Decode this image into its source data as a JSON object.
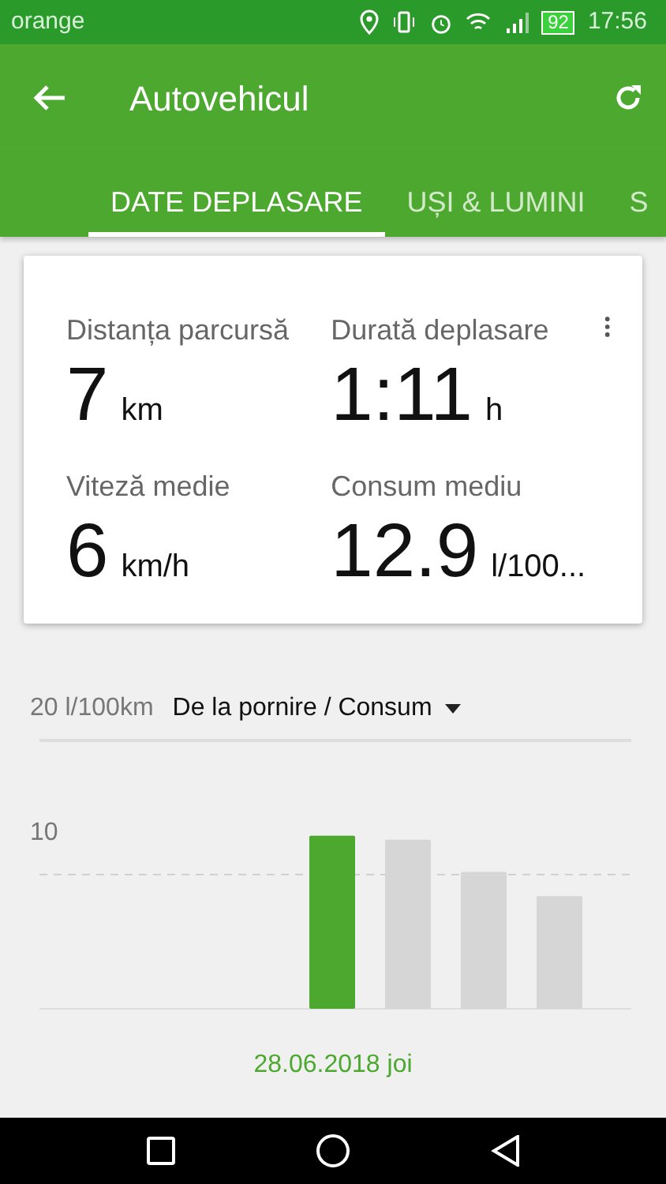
{
  "status_bar": {
    "carrier": "orange",
    "battery": "92",
    "time": "17:56"
  },
  "app_bar": {
    "title": "Autovehicul"
  },
  "tabs": [
    {
      "label": "DATE DEPLASARE",
      "selected": true
    },
    {
      "label": "UȘI & LUMINI",
      "selected": false
    },
    {
      "label": "S",
      "selected": false
    }
  ],
  "stats": [
    {
      "label": "Distanța parcursă",
      "value": "7",
      "unit": "km"
    },
    {
      "label": "Durată deplasare",
      "value": "1:11",
      "unit": "h"
    },
    {
      "label": "Viteză medie",
      "value": "6",
      "unit": "km/h"
    },
    {
      "label": "Consum mediu",
      "value": "12.9",
      "unit": "l/100..."
    }
  ],
  "chart": {
    "dropdown": "De la pornire / Consum",
    "date": "28.06.2018 joi",
    "axis_labels": [
      "20 l/100km",
      "10"
    ],
    "bars": [
      {
        "selected": true
      },
      {
        "selected": false
      },
      {
        "selected": false
      },
      {
        "selected": false
      }
    ]
  }
}
